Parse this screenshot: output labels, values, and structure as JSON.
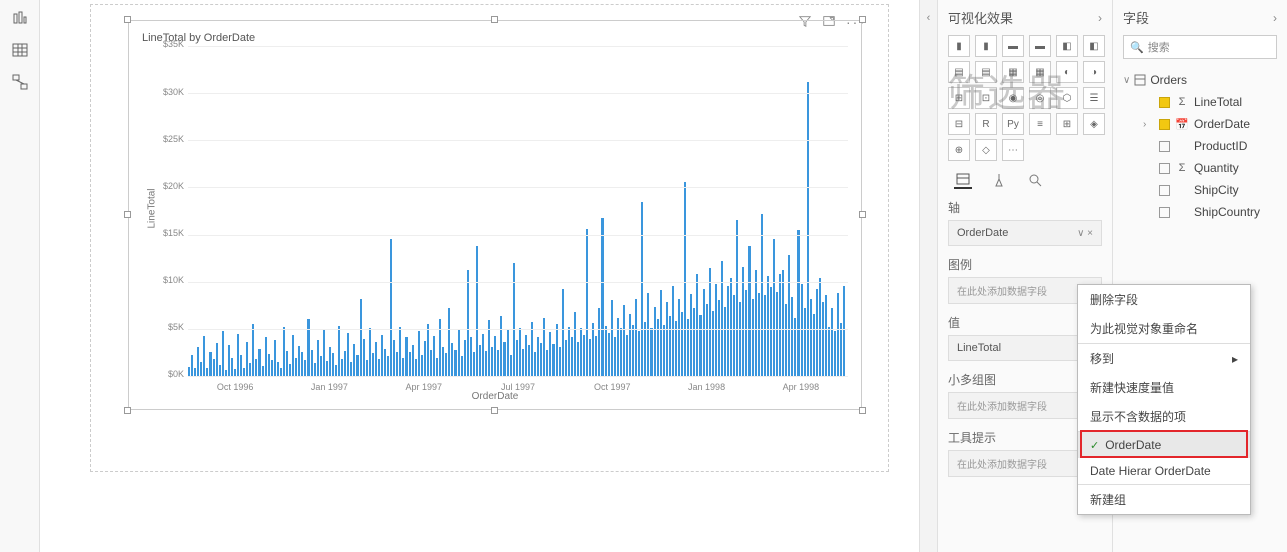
{
  "left_tools": [
    "report-view",
    "data-view",
    "model-view"
  ],
  "visual_toolbar": [
    "filter",
    "focus",
    "more"
  ],
  "chart": {
    "title": "LineTotal by OrderDate",
    "y_label": "LineTotal",
    "x_label": "OrderDate"
  },
  "chart_data": {
    "type": "bar",
    "ylabel": "LineTotal",
    "xlabel": "OrderDate",
    "ylim": [
      0,
      35000
    ],
    "y_ticks": [
      "$0K",
      "$5K",
      "$10K",
      "$15K",
      "$20K",
      "$25K",
      "$30K",
      "$35K"
    ],
    "x_ticks": [
      "Oct 1996",
      "Jan 1997",
      "Apr 1997",
      "Jul 1997",
      "Oct 1997",
      "Jan 1998",
      "Apr 1998"
    ],
    "values": [
      1000,
      2200,
      800,
      3100,
      1500,
      4200,
      900,
      2500,
      1800,
      3500,
      1200,
      4800,
      600,
      3300,
      1900,
      700,
      4500,
      2200,
      800,
      3600,
      1400,
      5500,
      1800,
      2900,
      1100,
      4100,
      2300,
      1700,
      3800,
      1500,
      900,
      5200,
      2700,
      1300,
      4400,
      1900,
      3200,
      2500,
      1700,
      6100,
      2800,
      1400,
      3800,
      2100,
      4900,
      1600,
      3100,
      2400,
      1200,
      5300,
      1800,
      2700,
      4600,
      1500,
      3400,
      2200,
      8200,
      3900,
      1700,
      5100,
      2400,
      3600,
      1800,
      4300,
      2900,
      2100,
      14500,
      3800,
      2500,
      5200,
      1900,
      4100,
      2600,
      3300,
      1800,
      4800,
      2200,
      3700,
      5500,
      2800,
      4200,
      1900,
      6100,
      3100,
      2400,
      7200,
      3500,
      2800,
      4900,
      2100,
      3800,
      11200,
      4100,
      2500,
      13800,
      3300,
      4500,
      2700,
      5900,
      3100,
      4200,
      2800,
      6400,
      3600,
      4900,
      2200,
      12000,
      3800,
      5100,
      2900,
      4400,
      3300,
      5700,
      2600,
      4100,
      3500,
      6200,
      2800,
      4700,
      3400,
      5500,
      3100,
      9200,
      3800,
      5200,
      4100,
      6800,
      3600,
      5100,
      4400,
      15600,
      3900,
      5600,
      4200,
      7200,
      16800,
      5300,
      4600,
      8100,
      4100,
      6200,
      5100,
      7500,
      4400,
      6600,
      5400,
      8200,
      4800,
      18500,
      5700,
      8800,
      5100,
      7300,
      6100,
      9100,
      5400,
      7800,
      6400,
      9600,
      5800,
      8200,
      6800,
      20600,
      6100,
      8700,
      7200,
      10800,
      6500,
      9200,
      7600,
      11500,
      6900,
      9800,
      8100,
      12200,
      7300,
      9500,
      10400,
      8600,
      16500,
      7800,
      11600,
      9100,
      13800,
      8200,
      11200,
      8800,
      17200,
      8600,
      10600,
      9400,
      14500,
      8900,
      10800,
      11200,
      7600,
      12800,
      8400,
      6200,
      15500,
      9800,
      7200,
      31200,
      8200,
      6600,
      9200,
      10400,
      7800,
      8600,
      5200,
      7200,
      4800,
      8800,
      5600,
      9600
    ]
  },
  "watermark": "Y 筛选器",
  "viz_panel": {
    "title": "可视化效果",
    "wells": {
      "axis": {
        "label": "轴",
        "value": "OrderDate"
      },
      "legend": {
        "label": "图例",
        "placeholder": "在此处添加数据字段"
      },
      "value": {
        "label": "值",
        "value_text": "LineTotal"
      },
      "small_mult": {
        "label": "小多组图",
        "placeholder": "在此处添加数据字段"
      },
      "tooltip": {
        "label": "工具提示",
        "placeholder": "在此处添加数据字段"
      }
    }
  },
  "fields_panel": {
    "title": "字段",
    "search_placeholder": "搜索",
    "table": "Orders",
    "fields": [
      {
        "name": "LineTotal",
        "checked": true,
        "kind": "sum"
      },
      {
        "name": "OrderDate",
        "checked": true,
        "kind": "date",
        "expandable": true
      },
      {
        "name": "ProductID",
        "checked": false,
        "kind": "none"
      },
      {
        "name": "Quantity",
        "checked": false,
        "kind": "sum"
      },
      {
        "name": "ShipCity",
        "checked": false,
        "kind": "none"
      },
      {
        "name": "ShipCountry",
        "checked": false,
        "kind": "none"
      }
    ]
  },
  "context_menu": {
    "items": [
      {
        "label": "删除字段"
      },
      {
        "label": "为此视觉对象重命名"
      },
      {
        "label": "移到",
        "arrow": true
      },
      {
        "label": "新建快速度量值"
      },
      {
        "label": "显示不含数据的项"
      },
      {
        "label": "OrderDate",
        "selected": true,
        "checked": true,
        "highlight": true
      },
      {
        "label": "Date Hierar  OrderDate"
      },
      {
        "label": "新建组"
      }
    ]
  }
}
